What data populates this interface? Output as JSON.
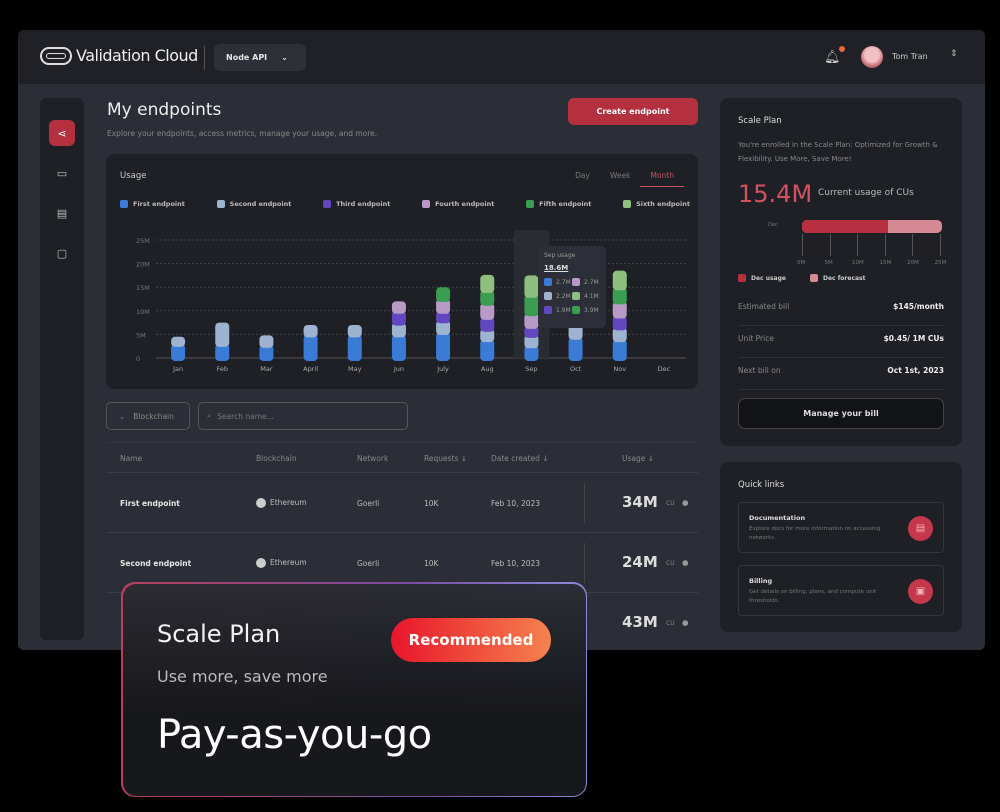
{
  "header": {
    "brand": "Validation Cloud",
    "product_select": "Node API",
    "user_name": "Tom Tran",
    "notification_badge": true
  },
  "sidebar": {
    "items": [
      {
        "icon": "endpoints-icon",
        "active": true
      },
      {
        "icon": "card-icon"
      },
      {
        "icon": "document-icon"
      },
      {
        "icon": "chat-icon"
      }
    ]
  },
  "page": {
    "title": "My endpoints",
    "subtitle": "Explore your endpoints, access metrics, manage your usage, and more.",
    "create_button": "Create endpoint"
  },
  "usage": {
    "title": "Usage",
    "tabs": [
      "Day",
      "Week",
      "Month"
    ],
    "active_tab": "Month"
  },
  "chart_data": {
    "type": "bar",
    "stacked": true,
    "categories": [
      "Jan",
      "Feb",
      "Mar",
      "April",
      "May",
      "Jun",
      "July",
      "Aug",
      "Sep",
      "Oct",
      "Nov",
      "Dec"
    ],
    "yticks": [
      "0",
      "5M",
      "10M",
      "15M",
      "20M",
      "25M"
    ],
    "ylim": [
      0,
      25
    ],
    "grid": true,
    "legend": "top",
    "series": [
      {
        "name": "First endpoint",
        "color": "#3a7bd5",
        "values": [
          3,
          3,
          2.8,
          5,
          5,
          5,
          5.5,
          4,
          2.7,
          4.5,
          4,
          0
        ]
      },
      {
        "name": "Second endpoint",
        "color": "#9db3d0",
        "values": [
          1.5,
          4.5,
          2,
          2,
          2,
          2.5,
          2.5,
          2.2,
          2.2,
          2.5,
          2.5,
          0
        ]
      },
      {
        "name": "Third endpoint",
        "color": "#6248c0",
        "values": [
          0,
          0,
          0,
          0,
          0,
          2.5,
          2,
          2.5,
          1.9,
          2,
          2.5,
          0
        ]
      },
      {
        "name": "Fourth endpoint",
        "color": "#b79ac6",
        "values": [
          0,
          0,
          0,
          0,
          0,
          2,
          2.5,
          3,
          2.7,
          2.5,
          3,
          0
        ]
      },
      {
        "name": "Fifth endpoint",
        "color": "#3a9e52",
        "values": [
          0,
          0,
          0,
          0,
          0,
          0,
          2.5,
          2.7,
          3.9,
          3,
          3,
          0
        ]
      },
      {
        "name": "Sixth endpoint",
        "color": "#8fbf7f",
        "values": [
          0,
          0,
          0,
          0,
          0,
          0,
          0,
          3.2,
          4.1,
          3.5,
          3.5,
          0
        ]
      }
    ],
    "tooltip": {
      "title": "Sep usage",
      "total": "18.6M",
      "items": [
        {
          "color": "#3a7bd5",
          "value": "2.7M"
        },
        {
          "color": "#b79ac6",
          "value": "2.7M"
        },
        {
          "color": "#9db3d0",
          "value": "2.2M"
        },
        {
          "color": "#8fbf7f",
          "value": "4.1M"
        },
        {
          "color": "#6248c0",
          "value": "1.9M"
        },
        {
          "color": "#3a9e52",
          "value": "3.9M"
        }
      ]
    }
  },
  "filters": {
    "blockchain": "Blockchain",
    "search_placeholder": "Search name..."
  },
  "table": {
    "columns": [
      "Name",
      "Blockchain",
      "Network",
      "Requests ↓",
      "Date created ↓",
      "Usage ↓"
    ],
    "rows": [
      {
        "name": "First endpoint",
        "blockchain": "Ethereum",
        "network": "Goerli",
        "requests": "10K",
        "date": "Feb 10, 2023",
        "usage": "34M",
        "unit": "CU"
      },
      {
        "name": "Second endpoint",
        "blockchain": "Ethereum",
        "network": "Goerli",
        "requests": "10K",
        "date": "Feb 10, 2023",
        "usage": "24M",
        "unit": "CU"
      },
      {
        "usage": "43M",
        "unit": "CU"
      }
    ]
  },
  "plan": {
    "title": "Scale Plan",
    "desc": "You're enrolled in the Scale Plan: Optimized for Growth & Flexibility. Use More, Save More!",
    "usage_value": "15.4M",
    "usage_label": "Current usage of CUs",
    "bar_label": "Dec",
    "usage_m": 15.4,
    "forecast_m": 25,
    "ticks": [
      "0M",
      "5M",
      "10M",
      "15M",
      "20M",
      "25M"
    ],
    "legend_usage": "Dec usage",
    "legend_forecast": "Dec forecast",
    "rows": [
      {
        "k": "Estimated bill",
        "v": "$145/month"
      },
      {
        "k": "Unit Price",
        "v": "$0.45/ 1M CUs"
      },
      {
        "k": "Next bill on",
        "v": "Oct 1st, 2023"
      }
    ],
    "manage_button": "Manage your bill",
    "colors": {
      "usage": "#b73041",
      "forecast": "#d68a93"
    }
  },
  "quick_links": {
    "title": "Quick links",
    "items": [
      {
        "title": "Documentation",
        "desc": "Explore docs for more information on accessing networks."
      },
      {
        "title": "Billing",
        "desc": "Get details on billing, plans, and compute unit thresholds."
      }
    ]
  },
  "promo": {
    "title": "Scale Plan",
    "badge": "Recommended",
    "subtitle": "Use more, save more",
    "pricing": "Pay-as-you-go"
  }
}
